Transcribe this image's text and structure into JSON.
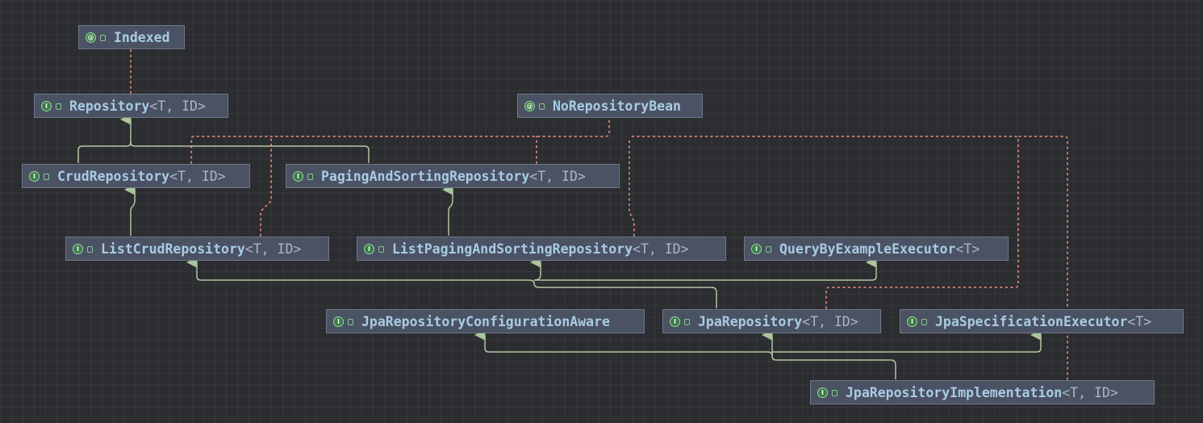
{
  "diagram": {
    "colors": {
      "background": "#2b2d30",
      "node_fill": "#4a5263",
      "node_border": "#6f7788",
      "extends_line": "#b3c5a0",
      "annotation_line": "#c97a6e"
    },
    "nodes": [
      {
        "id": "indexed",
        "kind": "annotation",
        "kind_glyph": "@",
        "name": "Indexed",
        "params": ""
      },
      {
        "id": "repository",
        "kind": "interface",
        "kind_glyph": "I",
        "name": "Repository",
        "params": "<T, ID>"
      },
      {
        "id": "norepositorybean",
        "kind": "annotation",
        "kind_glyph": "@",
        "name": "NoRepositoryBean",
        "params": ""
      },
      {
        "id": "crudrepository",
        "kind": "interface",
        "kind_glyph": "I",
        "name": "CrudRepository",
        "params": "<T, ID>"
      },
      {
        "id": "pagingandsortingrepository",
        "kind": "interface",
        "kind_glyph": "I",
        "name": "PagingAndSortingRepository",
        "params": "<T, ID>"
      },
      {
        "id": "listcrudrepository",
        "kind": "interface",
        "kind_glyph": "I",
        "name": "ListCrudRepository",
        "params": "<T, ID>"
      },
      {
        "id": "listpagingandsortingrepository",
        "kind": "interface",
        "kind_glyph": "I",
        "name": "ListPagingAndSortingRepository",
        "params": "<T, ID>"
      },
      {
        "id": "querybyexampleexecutor",
        "kind": "interface",
        "kind_glyph": "I",
        "name": "QueryByExampleExecutor",
        "params": "<T>"
      },
      {
        "id": "jparepositoryconfigurationaware",
        "kind": "interface",
        "kind_glyph": "I",
        "name": "JpaRepositoryConfigurationAware",
        "params": ""
      },
      {
        "id": "jparepository",
        "kind": "interface",
        "kind_glyph": "I",
        "name": "JpaRepository",
        "params": "<T, ID>"
      },
      {
        "id": "jpaspecificationexecutor",
        "kind": "interface",
        "kind_glyph": "I",
        "name": "JpaSpecificationExecutor",
        "params": "<T>"
      },
      {
        "id": "jparepositoryimplementation",
        "kind": "interface",
        "kind_glyph": "I",
        "name": "JpaRepositoryImplementation",
        "params": "<T, ID>"
      }
    ],
    "edges": [
      {
        "from": "crudrepository",
        "to": "repository",
        "type": "extends"
      },
      {
        "from": "pagingandsortingrepository",
        "to": "repository",
        "type": "extends"
      },
      {
        "from": "listcrudrepository",
        "to": "crudrepository",
        "type": "extends"
      },
      {
        "from": "listpagingandsortingrepository",
        "to": "pagingandsortingrepository",
        "type": "extends"
      },
      {
        "from": "jparepository",
        "to": "listcrudrepository",
        "type": "extends"
      },
      {
        "from": "jparepository",
        "to": "listpagingandsortingrepository",
        "type": "extends"
      },
      {
        "from": "jparepository",
        "to": "querybyexampleexecutor",
        "type": "extends"
      },
      {
        "from": "jparepositoryimplementation",
        "to": "jparepository",
        "type": "extends"
      },
      {
        "from": "jparepositoryimplementation",
        "to": "jparepositoryconfigurationaware",
        "type": "extends"
      },
      {
        "from": "jparepositoryimplementation",
        "to": "jpaspecificationexecutor",
        "type": "extends"
      },
      {
        "from": "repository",
        "to": "indexed",
        "type": "annotated"
      },
      {
        "from": "crudrepository",
        "to": "norepositorybean",
        "type": "annotated"
      },
      {
        "from": "pagingandsortingrepository",
        "to": "norepositorybean",
        "type": "annotated"
      },
      {
        "from": "listcrudrepository",
        "to": "norepositorybean",
        "type": "annotated"
      },
      {
        "from": "listpagingandsortingrepository",
        "to": "norepositorybean",
        "type": "annotated"
      },
      {
        "from": "jparepository",
        "to": "norepositorybean",
        "type": "annotated"
      },
      {
        "from": "jparepositoryimplementation",
        "to": "norepositorybean",
        "type": "annotated"
      }
    ]
  }
}
